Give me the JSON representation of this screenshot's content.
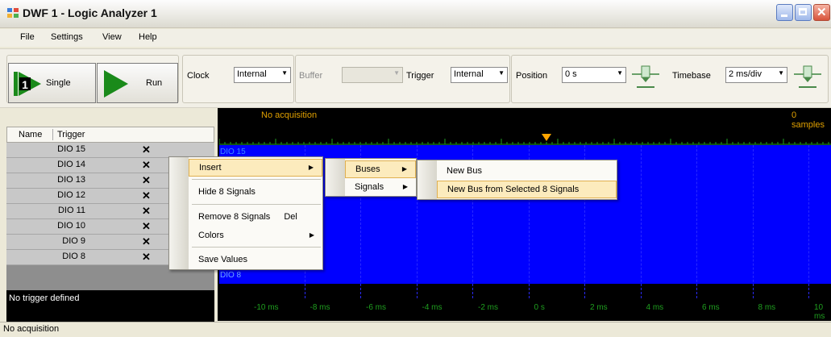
{
  "window": {
    "title": "DWF 1 - Logic Analyzer 1"
  },
  "menu": [
    "File",
    "Settings",
    "View",
    "Help"
  ],
  "toolbar": {
    "single_label": "Single",
    "run_label": "Run",
    "clock_label": "Clock",
    "clock_value": "Internal",
    "buffer_label": "Buffer",
    "buffer_value": "",
    "trigger_label": "Trigger",
    "trigger_value": "Internal",
    "position_label": "Position",
    "position_value": "0 s",
    "timebase_label": "Timebase",
    "timebase_value": "2 ms/div"
  },
  "signal_list": {
    "headers": {
      "name": "Name",
      "trigger": "Trigger"
    },
    "signals": [
      {
        "name": "DIO 15",
        "trigger": "✕"
      },
      {
        "name": "DIO 14",
        "trigger": "✕"
      },
      {
        "name": "DIO 13",
        "trigger": "✕"
      },
      {
        "name": "DIO 12",
        "trigger": "✕"
      },
      {
        "name": "DIO 11",
        "trigger": "✕"
      },
      {
        "name": "DIO 10",
        "trigger": "✕"
      },
      {
        "name": "DIO 9",
        "trigger": "✕"
      },
      {
        "name": "DIO 8",
        "trigger": "✕"
      }
    ],
    "no_trigger": "No trigger defined"
  },
  "plot": {
    "status": "No acquisition",
    "samples": "0 samples",
    "top_signal": "DIO 15",
    "bottom_signal": "DIO 8",
    "x_ticks": [
      "-10 ms",
      "-8 ms",
      "-6 ms",
      "-4 ms",
      "-2 ms",
      "0 s",
      "2 ms",
      "4 ms",
      "6 ms",
      "8 ms",
      "10 ms"
    ]
  },
  "context_menu": {
    "insert": "Insert",
    "hide": "Hide 8 Signals",
    "remove": "Remove 8 Signals",
    "remove_shortcut": "Del",
    "colors": "Colors",
    "save_values": "Save Values"
  },
  "submenu_insert": {
    "buses": "Buses",
    "signals": "Signals"
  },
  "submenu_buses": {
    "new_bus": "New Bus",
    "new_bus_selected": "New Bus from Selected 8 Signals"
  },
  "statusbar": {
    "text": "No acquisition"
  },
  "colors": {
    "plot_background": "#0000ff",
    "tick_color": "#1f9f1f",
    "trigger_marker": "#ffa500"
  }
}
